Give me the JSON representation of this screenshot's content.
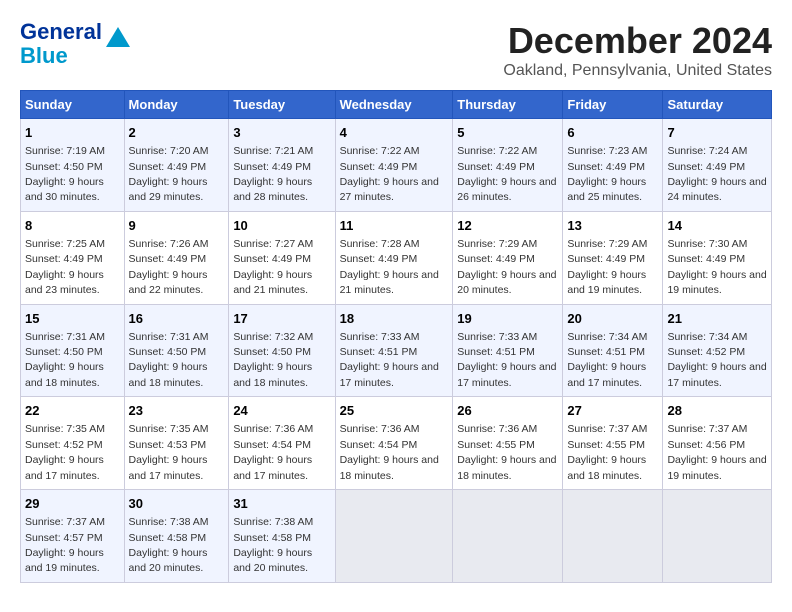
{
  "logo": {
    "line1": "General",
    "line2": "Blue"
  },
  "title": "December 2024",
  "subtitle": "Oakland, Pennsylvania, United States",
  "days_of_week": [
    "Sunday",
    "Monday",
    "Tuesday",
    "Wednesday",
    "Thursday",
    "Friday",
    "Saturday"
  ],
  "weeks": [
    [
      {
        "day": "1",
        "sunrise": "7:19 AM",
        "sunset": "4:50 PM",
        "daylight": "9 hours and 30 minutes."
      },
      {
        "day": "2",
        "sunrise": "7:20 AM",
        "sunset": "4:49 PM",
        "daylight": "9 hours and 29 minutes."
      },
      {
        "day": "3",
        "sunrise": "7:21 AM",
        "sunset": "4:49 PM",
        "daylight": "9 hours and 28 minutes."
      },
      {
        "day": "4",
        "sunrise": "7:22 AM",
        "sunset": "4:49 PM",
        "daylight": "9 hours and 27 minutes."
      },
      {
        "day": "5",
        "sunrise": "7:22 AM",
        "sunset": "4:49 PM",
        "daylight": "9 hours and 26 minutes."
      },
      {
        "day": "6",
        "sunrise": "7:23 AM",
        "sunset": "4:49 PM",
        "daylight": "9 hours and 25 minutes."
      },
      {
        "day": "7",
        "sunrise": "7:24 AM",
        "sunset": "4:49 PM",
        "daylight": "9 hours and 24 minutes."
      }
    ],
    [
      {
        "day": "8",
        "sunrise": "7:25 AM",
        "sunset": "4:49 PM",
        "daylight": "9 hours and 23 minutes."
      },
      {
        "day": "9",
        "sunrise": "7:26 AM",
        "sunset": "4:49 PM",
        "daylight": "9 hours and 22 minutes."
      },
      {
        "day": "10",
        "sunrise": "7:27 AM",
        "sunset": "4:49 PM",
        "daylight": "9 hours and 21 minutes."
      },
      {
        "day": "11",
        "sunrise": "7:28 AM",
        "sunset": "4:49 PM",
        "daylight": "9 hours and 21 minutes."
      },
      {
        "day": "12",
        "sunrise": "7:29 AM",
        "sunset": "4:49 PM",
        "daylight": "9 hours and 20 minutes."
      },
      {
        "day": "13",
        "sunrise": "7:29 AM",
        "sunset": "4:49 PM",
        "daylight": "9 hours and 19 minutes."
      },
      {
        "day": "14",
        "sunrise": "7:30 AM",
        "sunset": "4:49 PM",
        "daylight": "9 hours and 19 minutes."
      }
    ],
    [
      {
        "day": "15",
        "sunrise": "7:31 AM",
        "sunset": "4:50 PM",
        "daylight": "9 hours and 18 minutes."
      },
      {
        "day": "16",
        "sunrise": "7:31 AM",
        "sunset": "4:50 PM",
        "daylight": "9 hours and 18 minutes."
      },
      {
        "day": "17",
        "sunrise": "7:32 AM",
        "sunset": "4:50 PM",
        "daylight": "9 hours and 18 minutes."
      },
      {
        "day": "18",
        "sunrise": "7:33 AM",
        "sunset": "4:51 PM",
        "daylight": "9 hours and 17 minutes."
      },
      {
        "day": "19",
        "sunrise": "7:33 AM",
        "sunset": "4:51 PM",
        "daylight": "9 hours and 17 minutes."
      },
      {
        "day": "20",
        "sunrise": "7:34 AM",
        "sunset": "4:51 PM",
        "daylight": "9 hours and 17 minutes."
      },
      {
        "day": "21",
        "sunrise": "7:34 AM",
        "sunset": "4:52 PM",
        "daylight": "9 hours and 17 minutes."
      }
    ],
    [
      {
        "day": "22",
        "sunrise": "7:35 AM",
        "sunset": "4:52 PM",
        "daylight": "9 hours and 17 minutes."
      },
      {
        "day": "23",
        "sunrise": "7:35 AM",
        "sunset": "4:53 PM",
        "daylight": "9 hours and 17 minutes."
      },
      {
        "day": "24",
        "sunrise": "7:36 AM",
        "sunset": "4:54 PM",
        "daylight": "9 hours and 17 minutes."
      },
      {
        "day": "25",
        "sunrise": "7:36 AM",
        "sunset": "4:54 PM",
        "daylight": "9 hours and 18 minutes."
      },
      {
        "day": "26",
        "sunrise": "7:36 AM",
        "sunset": "4:55 PM",
        "daylight": "9 hours and 18 minutes."
      },
      {
        "day": "27",
        "sunrise": "7:37 AM",
        "sunset": "4:55 PM",
        "daylight": "9 hours and 18 minutes."
      },
      {
        "day": "28",
        "sunrise": "7:37 AM",
        "sunset": "4:56 PM",
        "daylight": "9 hours and 19 minutes."
      }
    ],
    [
      {
        "day": "29",
        "sunrise": "7:37 AM",
        "sunset": "4:57 PM",
        "daylight": "9 hours and 19 minutes."
      },
      {
        "day": "30",
        "sunrise": "7:38 AM",
        "sunset": "4:58 PM",
        "daylight": "9 hours and 20 minutes."
      },
      {
        "day": "31",
        "sunrise": "7:38 AM",
        "sunset": "4:58 PM",
        "daylight": "9 hours and 20 minutes."
      },
      null,
      null,
      null,
      null
    ]
  ],
  "labels": {
    "sunrise": "Sunrise:",
    "sunset": "Sunset:",
    "daylight": "Daylight:"
  }
}
